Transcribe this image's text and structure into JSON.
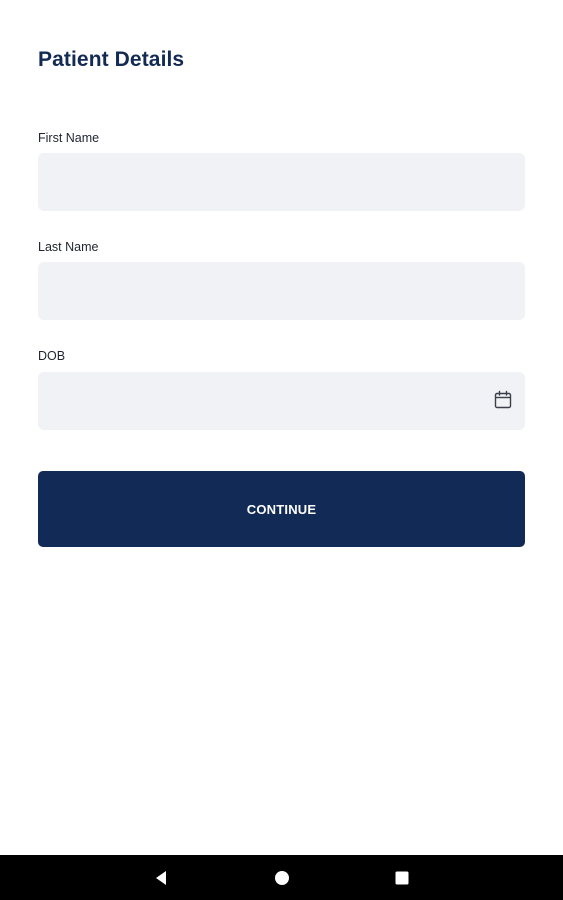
{
  "page": {
    "title": "Patient Details"
  },
  "form": {
    "first_name": {
      "label": "First Name",
      "value": "",
      "placeholder": ""
    },
    "last_name": {
      "label": "Last Name",
      "value": "",
      "placeholder": ""
    },
    "dob": {
      "label": "DOB",
      "value": "",
      "placeholder": "",
      "icon": "calendar-icon"
    },
    "continue_label": "CONTINUE"
  },
  "system_nav": {
    "back_icon": "back-triangle-icon",
    "home_icon": "home-circle-icon",
    "recents_icon": "recents-square-icon"
  },
  "colors": {
    "title": "#132a55",
    "button_bg": "#112a56",
    "input_bg": "#f1f2f5",
    "nav_bg": "#000000"
  }
}
